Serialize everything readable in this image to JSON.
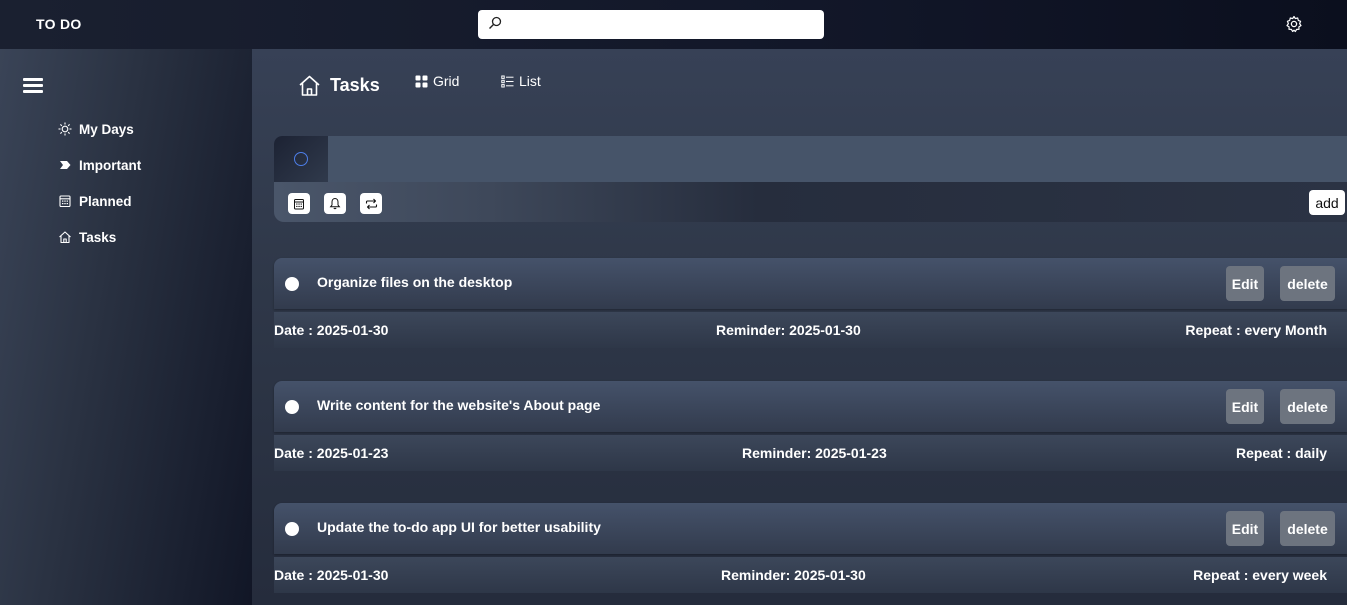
{
  "app": {
    "title": "TO DO"
  },
  "search": {
    "placeholder": "",
    "value": ""
  },
  "sidebar": {
    "items": [
      {
        "label": "My Days",
        "icon": "sun-icon"
      },
      {
        "label": "Important",
        "icon": "arrow-tag-icon"
      },
      {
        "label": "Planned",
        "icon": "calendar-icon"
      },
      {
        "label": "Tasks",
        "icon": "home-icon"
      }
    ]
  },
  "main": {
    "title": "Tasks",
    "views": [
      {
        "label": "Grid",
        "icon": "grid-icon"
      },
      {
        "label": "List",
        "icon": "list-icon"
      }
    ]
  },
  "composer": {
    "placeholder": "",
    "add_label": "add",
    "accent": "#4d7ee8"
  },
  "tasks": [
    {
      "title": "Organize files on the desktop",
      "date": "Date : 2025-01-30",
      "reminder": "Reminder: 2025-01-30",
      "repeat": "Repeat : every Month",
      "edit_label": "Edit",
      "delete_label": "delete"
    },
    {
      "title": "Write content for the website's About page",
      "date": "Date : 2025-01-23",
      "reminder": "Reminder: 2025-01-23",
      "repeat": "Repeat : daily",
      "edit_label": "Edit",
      "delete_label": "delete"
    },
    {
      "title": "Update the to-do app UI for better usability",
      "date": "Date : 2025-01-30",
      "reminder": "Reminder: 2025-01-30",
      "repeat": "Repeat : every week",
      "edit_label": "Edit",
      "delete_label": "delete"
    }
  ]
}
